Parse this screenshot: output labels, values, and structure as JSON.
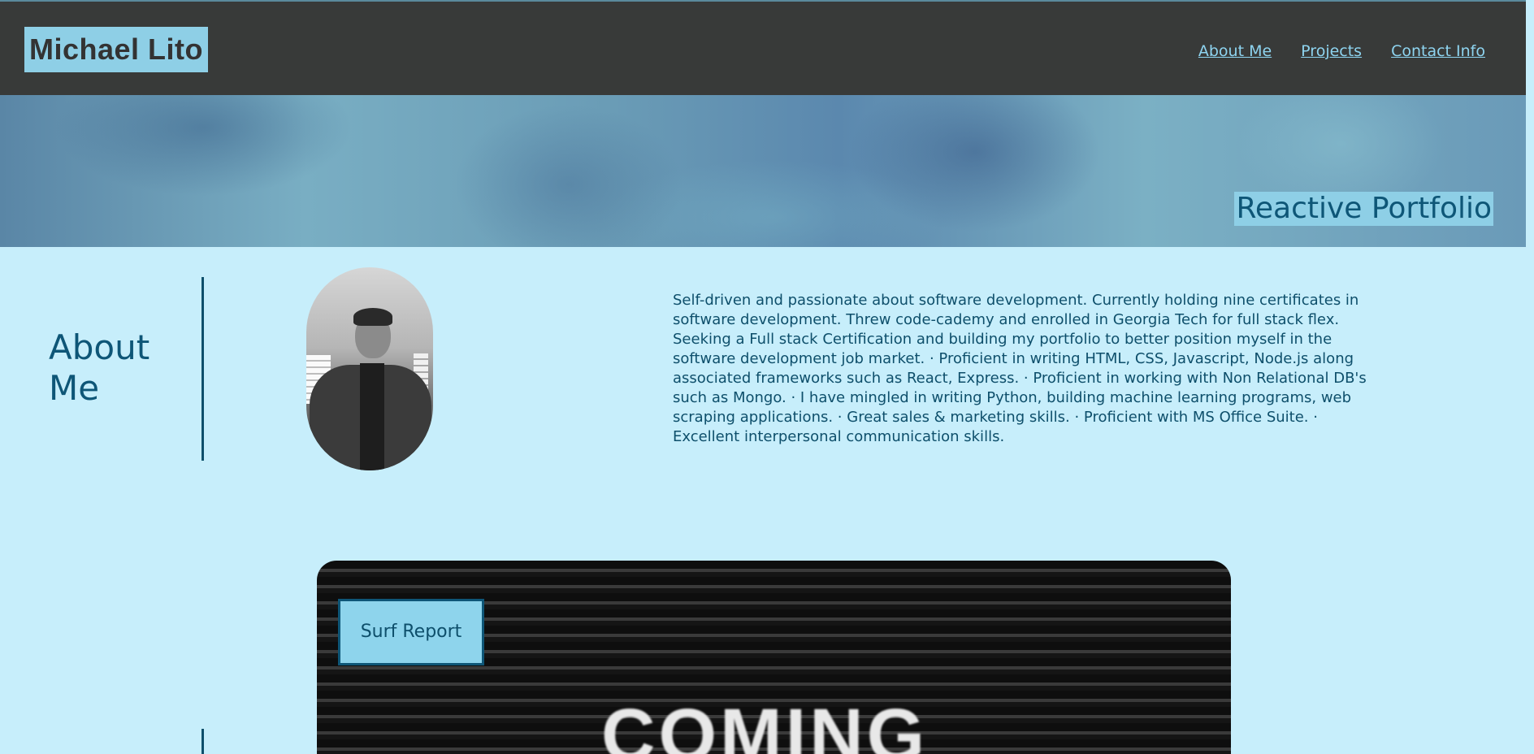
{
  "header": {
    "brand": "Michael Lito",
    "nav": [
      "About Me",
      "Projects",
      "Contact Info"
    ]
  },
  "hero": {
    "title": "Reactive Portfolio"
  },
  "about": {
    "heading": "About Me",
    "bio": "Self-driven and passionate about software development. Currently holding nine certificates in software development. Threw code-cademy and enrolled in Georgia Tech for full stack flex. Seeking a Full stack Certification and building my portfolio to better position myself in the software development job market. · Proficient in writing HTML, CSS, Javascript, Node.js along associated frameworks such as React, Express. · Proficient in working with Non Relational DB's such as Mongo. · I have mingled in writing Python, building machine learning programs, web scraping applications. · Great sales & marketing skills. · Proficient with MS Office Suite. · Excellent interpersonal communication skills."
  },
  "projects": {
    "card_button": "Surf Report",
    "card_image_text": "COMING"
  },
  "colors": {
    "background": "#c7eefb",
    "header": "#383a39",
    "accent": "#8ecfe6",
    "text": "#0e4f6b"
  }
}
